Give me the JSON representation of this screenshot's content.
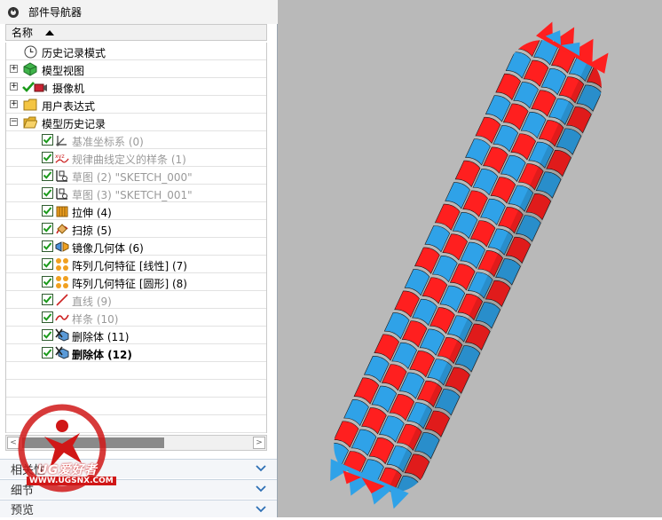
{
  "navigator": {
    "title": "部件导航器",
    "column_header": "名称",
    "items": [
      {
        "label": "历史记录模式",
        "style": "normal"
      },
      {
        "label": "模型视图",
        "style": "normal"
      },
      {
        "label": "摄像机",
        "style": "normal"
      },
      {
        "label": "用户表达式",
        "style": "normal"
      },
      {
        "label": "模型历史记录",
        "style": "normal"
      },
      {
        "label": "基准坐标系 (0)",
        "style": "gray",
        "checked": true
      },
      {
        "label": "规律曲线定义的样条 (1)",
        "style": "gray",
        "checked": true
      },
      {
        "label": "草图 (2) \"SKETCH_000\"",
        "style": "gray",
        "checked": true
      },
      {
        "label": "草图 (3) \"SKETCH_001\"",
        "style": "gray",
        "checked": true
      },
      {
        "label": "拉伸 (4)",
        "style": "normal",
        "checked": true
      },
      {
        "label": "扫掠 (5)",
        "style": "normal",
        "checked": true
      },
      {
        "label": "镜像几何体 (6)",
        "style": "normal",
        "checked": true
      },
      {
        "label": "阵列几何特征 [线性] (7)",
        "style": "normal",
        "checked": true
      },
      {
        "label": "阵列几何特征 [圆形] (8)",
        "style": "normal",
        "checked": true
      },
      {
        "label": "直线 (9)",
        "style": "gray",
        "checked": true
      },
      {
        "label": "样条 (10)",
        "style": "gray",
        "checked": true
      },
      {
        "label": "删除体 (11)",
        "style": "normal",
        "checked": true
      },
      {
        "label": "删除体 (12)",
        "style": "bold",
        "checked": true
      }
    ],
    "sections": [
      {
        "label": "相关性"
      },
      {
        "label": "细节"
      },
      {
        "label": "预览"
      }
    ]
  },
  "watermark": {
    "brand": "UG爱好者",
    "url": "WWW.UGSNX.COM"
  },
  "colors": {
    "weave_red": "#ff1f1f",
    "weave_blue": "#2fa2e8",
    "viewport_bg": "#b9b9b9",
    "check_green": "#1a9a1a"
  }
}
